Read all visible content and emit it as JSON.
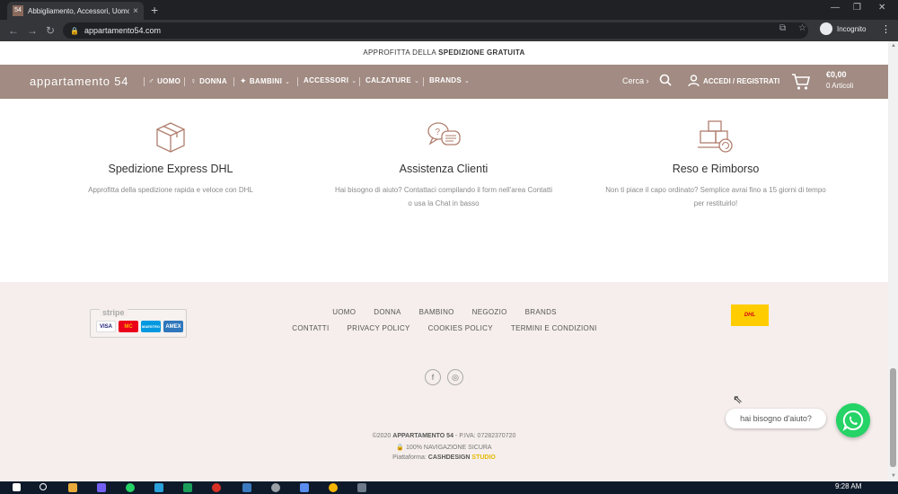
{
  "browser": {
    "tab_favicon": "54",
    "tab_title": "Abbigliamento, Accessori, Uomo",
    "tab_close": "×",
    "new_tab": "+",
    "back": "←",
    "forward": "→",
    "reload": "↻",
    "url": "appartamento54.com",
    "profile_label": "Incognito",
    "menu": "⋮"
  },
  "promo": {
    "prefix": "APPROFITTA DELLA ",
    "bold": "SPEDIZIONE GRATUITA"
  },
  "nav": {
    "logo": "appartamento 54",
    "items": [
      {
        "label": "UOMO",
        "icon": "man-icon",
        "glyph": "♂"
      },
      {
        "label": "DONNA",
        "icon": "woman-icon",
        "glyph": "♀"
      },
      {
        "label": "BAMBINI",
        "icon": "child-icon",
        "glyph": "✦"
      },
      {
        "label": "ACCESSORI",
        "chevron": "⌄"
      },
      {
        "label": "CALZATURE",
        "chevron": "⌄"
      },
      {
        "label": "BRANDS",
        "chevron": "⌄"
      }
    ],
    "search_label": "Cerca ›",
    "login_label": "ACCEDI / REGISTRATI",
    "cart_price": "€0,00",
    "cart_items": "0 Articoli"
  },
  "features": [
    {
      "icon": "box-icon",
      "title": "Spedizione Express DHL",
      "desc_line1": "Approfitta della spedizione rapida e veloce con DHL",
      "desc_line2": ""
    },
    {
      "icon": "chat-bubbles-icon",
      "title": "Assistenza Clienti",
      "desc_line1": "Hai bisogno di aiuto? Contattaci compilando il form nell'area Contatti",
      "desc_line2": "o usa la Chat in basso"
    },
    {
      "icon": "return-box-icon",
      "title": "Reso e Rimborso",
      "desc_line1": "Non ti piace il capo ordinato? Semplice avrai fino a 15 giorni di tempo",
      "desc_line2": "per restituirlo!"
    }
  ],
  "footer": {
    "stripe_label": "stripe",
    "cards": [
      "VISA",
      "MC",
      "MAESTRO",
      "AMEX"
    ],
    "links_row1": [
      "UOMO",
      "DONNA",
      "BAMBINO",
      "NEGOZIO",
      "BRANDS"
    ],
    "links_row2": [
      "CONTATTI",
      "PRIVACY POLICY",
      "COOKIES POLICY",
      "TERMINI E CONDIZIONI"
    ],
    "dhl_label": "DHL",
    "social": [
      "f",
      "◎"
    ],
    "copyright_prefix": "©2020 ",
    "copyright_brand": "APPARTAMENTO 54",
    "copyright_suffix": " - P.IVA: 07282370720",
    "secure": "🔒 100% NAVIGAZIONE SICURA",
    "platform_prefix": "Piattaforma: ",
    "platform_brand": "CASHDESIGN",
    "platform_suffix": " STUDIO"
  },
  "chat": {
    "label": "hai bisogno d'aiuto?"
  },
  "taskbar": {
    "clock": "9:28 AM"
  },
  "colors": {
    "nav_bg": "#a18b82",
    "footer_bg": "#f5eeec",
    "whatsapp": "#25d366",
    "dhl_yellow": "#ffcc00"
  }
}
